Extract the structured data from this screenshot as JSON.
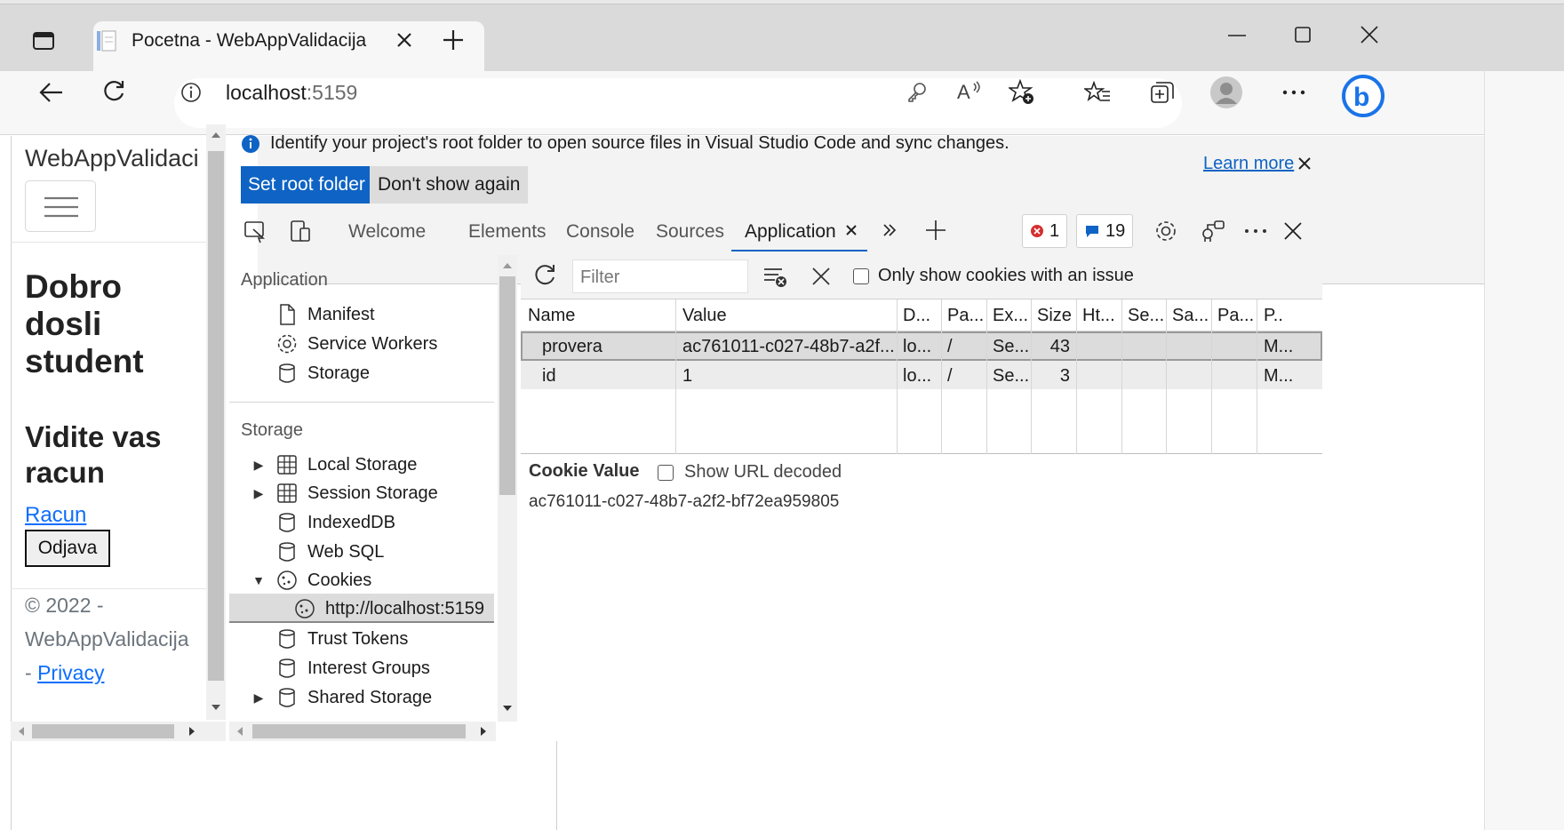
{
  "browser": {
    "tab_title": "Pocetna - WebAppValidacija",
    "url_host": "localhost",
    "url_port": ":5159",
    "window_controls": [
      "minimize",
      "maximize",
      "close"
    ]
  },
  "page": {
    "brand": "WebAppValidaci",
    "heading1_lines": [
      "Dobro",
      "dosli",
      "student"
    ],
    "heading2_lines": [
      "Vidite vas",
      "racun"
    ],
    "link_racun": "Racun",
    "logout_button": "Odjava",
    "footer_line1": "© 2022 -",
    "footer_line2": "WebAppValidacija",
    "footer_dash": "- ",
    "footer_privacy": "Privacy"
  },
  "devtools": {
    "infobar": {
      "message": "Identify your project's root folder to open source files in Visual Studio Code and sync changes.",
      "set_root": "Set root folder",
      "dont_show": "Don't show again",
      "learn_more": "Learn more"
    },
    "tabs": [
      "Welcome",
      "Elements",
      "Console",
      "Sources",
      "Application"
    ],
    "active_tab": "Application",
    "errors_count": "1",
    "messages_count": "19",
    "sidebar": {
      "application_title": "Application",
      "application_items": [
        "Manifest",
        "Service Workers",
        "Storage"
      ],
      "storage_title": "Storage",
      "storage_items": [
        "Local Storage",
        "Session Storage",
        "IndexedDB",
        "Web SQL",
        "Cookies",
        "http://localhost:5159",
        "Trust Tokens",
        "Interest Groups",
        "Shared Storage"
      ]
    },
    "cookies": {
      "filter_placeholder": "Filter",
      "only_issue_label": "Only show cookies with an issue",
      "columns": [
        "Name",
        "Value",
        "D...",
        "Pa...",
        "Ex...",
        "Size",
        "Ht...",
        "Se...",
        "Sa...",
        "Pa...",
        "P.."
      ],
      "rows": [
        [
          "provera",
          "ac761011-c027-48b7-a2f...",
          "lo...",
          "/",
          "Se...",
          "43",
          "",
          "",
          "",
          "",
          "M..."
        ],
        [
          "id",
          "1",
          "lo...",
          "/",
          "Se...",
          "3",
          "",
          "",
          "",
          "",
          "M..."
        ]
      ],
      "cookie_value_title": "Cookie Value",
      "show_url_decoded": "Show URL decoded",
      "cookie_value": "ac761011-c027-48b7-a2f2-bf72ea959805"
    }
  }
}
